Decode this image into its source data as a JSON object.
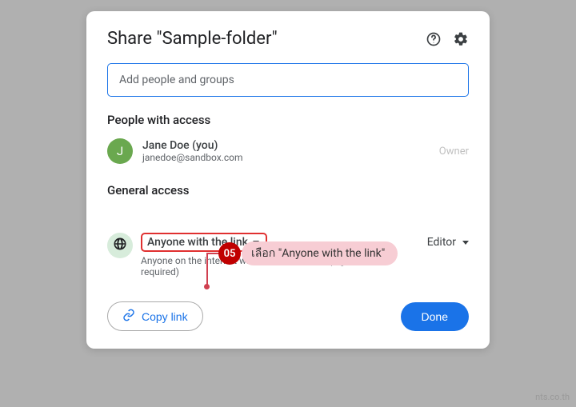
{
  "dialog": {
    "title": "Share \"Sample-folder\"",
    "add_people_placeholder": "Add people and groups"
  },
  "people_section": {
    "title": "People with access",
    "user": {
      "initial": "J",
      "name": "Jane Doe (you)",
      "email": "janedoe@sandbox.com"
    },
    "owner_label": "Owner"
  },
  "general_section": {
    "title": "General access",
    "dropdown_label": "Anyone with the link",
    "description": "Anyone on the internet with the link can edit (sign in required)",
    "role": "Editor"
  },
  "footer": {
    "copy_link": "Copy link",
    "done": "Done"
  },
  "annotation": {
    "number": "05",
    "text": "เลือก \"Anyone with the link\""
  },
  "watermark": "nts.co.th"
}
